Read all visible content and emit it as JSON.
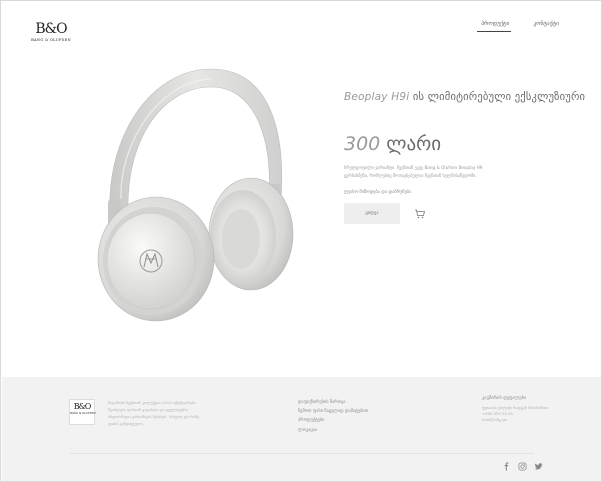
{
  "brand": {
    "logo_mark": "B&O",
    "logo_word": "BANG & OLUFSEN"
  },
  "nav": {
    "items": [
      {
        "label": "პროდუქტი",
        "active": true
      },
      {
        "label": "კონტაქტი",
        "active": false
      }
    ]
  },
  "product": {
    "model": "Beoplay H9i",
    "title_rest": " ის ლიმიტირებული ექსკლუზიური",
    "price_number": "300",
    "price_currency": " ლარი",
    "description": "სრულყოფილი ვარიანტი. ჩვენთან უკვე Bang & Olufsen Beoplay H9 ყურსასმენი, რომლებიც მოთავსებულია ჩვენთან ხელმისაწვდომი.",
    "colors_label": "უფასო მიწოდება და დაბრუნება",
    "buy_label": "ყიდვა",
    "image_icon": "headphones-image",
    "colors": {
      "headband": "#d9d9d7",
      "cup": "#e3e3e1",
      "metal": "#cfcfcd"
    }
  },
  "footer": {
    "logo_mark": "B&O",
    "logo_word": "BANG & OLUFSEN",
    "about": "მაღაზიის ჩვენთან კოლექცია 2014 აქსესუარები. შეიძლება ფასთან გადახდა და ყველაფერი. ინფორმაცია ვარიანტის შესახებ. სახელი და რამე ტიპის გამყიდველი.",
    "links": [
      "დაფიქსირების მართვა",
      "ზემოთ ფასი ნაცვლად დამატებით",
      "პროდუქტები",
      "ლოკაცია"
    ],
    "contact": {
      "heading": "კავშირის დეტალები",
      "lines": [
        "ქუთაისი ქალაქი რადგან მისამართი",
        "+995 555 55 55",
        "info@ბანგ.ge"
      ]
    },
    "social": [
      "facebook-icon",
      "instagram-icon",
      "twitter-icon"
    ]
  }
}
